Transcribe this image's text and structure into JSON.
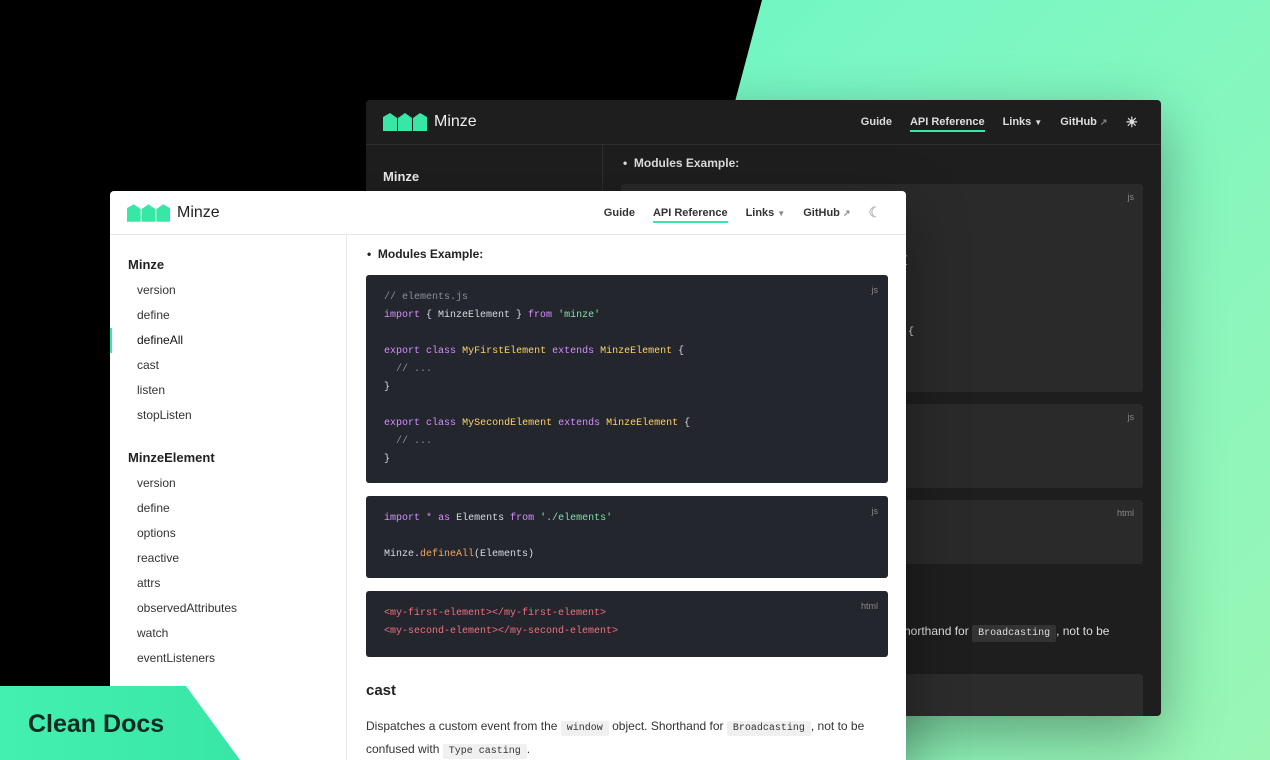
{
  "brand": "Minze",
  "nav": {
    "guide": "Guide",
    "api": "API Reference",
    "links": "Links",
    "github": "GitHub"
  },
  "dark": {
    "sidebar_heading": "Minze",
    "bullet": "Modules Example:",
    "langs": [
      "js",
      "js",
      "html"
    ],
    "fragments": {
      "f1": "nt {",
      "f2": "ent {"
    },
    "para_start": "horthand for",
    "para_code": "Broadcasting",
    "para_end": ", not to be"
  },
  "light": {
    "sections": [
      {
        "heading": "Minze",
        "items": [
          "version",
          "define",
          "defineAll",
          "cast",
          "listen",
          "stopListen"
        ]
      },
      {
        "heading": "MinzeElement",
        "items": [
          "version",
          "define",
          "options",
          "reactive",
          "attrs",
          "observedAttributes",
          "watch",
          "eventListeners"
        ]
      }
    ],
    "active_item": "defineAll",
    "bullet": "Modules Example:",
    "code1": {
      "lang": "js",
      "comment": "// elements.js",
      "import": "import",
      "import_mid": " { MinzeElement } ",
      "from": "from",
      "module": "'minze'",
      "export": "export",
      "class": "class",
      "extends": "extends",
      "class1": "MyFirstElement",
      "class2": "MySecondElement",
      "base": "MinzeElement",
      "ellipsis": "// ...",
      "open": "{",
      "close": "}"
    },
    "code2": {
      "lang": "js",
      "import": "import",
      "star": "*",
      "as": "as",
      "name": "Elements",
      "from": "from",
      "module": "'./elements'",
      "call_obj": "Minze.",
      "call_fn": "defineAll",
      "call_args": "(Elements)"
    },
    "code3": {
      "lang": "html",
      "tag1_open": "<my-first-element>",
      "tag1_close": "</my-first-element>",
      "tag2_open": "<my-second-element>",
      "tag2_close": "</my-second-element>"
    },
    "heading2": "cast",
    "para": {
      "p1": "Dispatches a custom event from the",
      "c1": "window",
      "p2": "object. Shorthand for",
      "c2": "Broadcasting",
      "p3": ", not to be confused with",
      "c3": "Type casting",
      "p4": "."
    }
  },
  "badge": "Clean Docs",
  "colors": {
    "accent": "#38e6a5"
  }
}
